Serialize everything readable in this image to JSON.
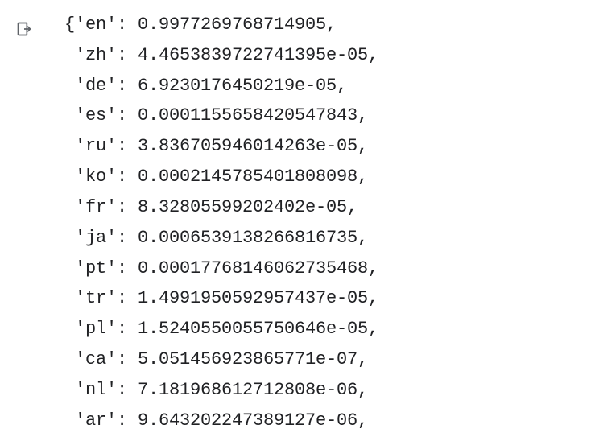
{
  "output": {
    "open_brace": "{",
    "entries": [
      {
        "key": "'en'",
        "value": "0.9977269768714905"
      },
      {
        "key": "'zh'",
        "value": "4.4653839722741395e-05"
      },
      {
        "key": "'de'",
        "value": "6.9230176450219e-05"
      },
      {
        "key": "'es'",
        "value": "0.0001155658420547843"
      },
      {
        "key": "'ru'",
        "value": "3.836705946014263e-05"
      },
      {
        "key": "'ko'",
        "value": "0.0002145785401808098"
      },
      {
        "key": "'fr'",
        "value": "8.32805599202402e-05"
      },
      {
        "key": "'ja'",
        "value": "0.0006539138266816735"
      },
      {
        "key": "'pt'",
        "value": "0.00017768146062735468"
      },
      {
        "key": "'tr'",
        "value": "1.4991950592957437e-05"
      },
      {
        "key": "'pl'",
        "value": "1.5240550055750646e-05"
      },
      {
        "key": "'ca'",
        "value": "5.051456923865771e-07"
      },
      {
        "key": "'nl'",
        "value": "7.181968612712808e-06"
      },
      {
        "key": "'ar'",
        "value": "9.643202247389127e-06"
      }
    ],
    "sep": ": ",
    "comma": ","
  }
}
